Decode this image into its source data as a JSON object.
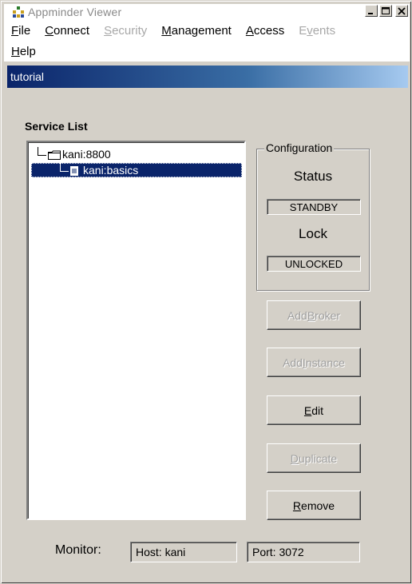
{
  "window": {
    "title": "Appminder Viewer",
    "controls": {
      "minimize": "_",
      "maximize": "□",
      "close": "×"
    }
  },
  "menu": {
    "items": [
      {
        "label": "File",
        "mnemonic": "F",
        "rest": "ile",
        "disabled": false
      },
      {
        "label": "Connect",
        "mnemonic": "C",
        "rest": "onnect",
        "disabled": false
      },
      {
        "label": "Security",
        "mnemonic": "S",
        "rest": "ecurity",
        "disabled": true
      },
      {
        "label": "Management",
        "mnemonic": "M",
        "rest": "anagement",
        "disabled": false
      },
      {
        "label": "Access",
        "mnemonic": "A",
        "rest": "ccess",
        "disabled": false
      },
      {
        "label": "Events",
        "pre": "E",
        "mnemonic": "v",
        "rest": "ents",
        "disabled": true
      },
      {
        "label": "Help",
        "mnemonic": "H",
        "rest": "elp",
        "disabled": false
      }
    ]
  },
  "inner_window": {
    "title": "tutorial"
  },
  "service_list": {
    "heading": "Service List",
    "nodes": [
      {
        "label": "kani:8800",
        "icon": "folder-icon"
      },
      {
        "label": "kani:basics",
        "icon": "document-icon",
        "selected": true
      }
    ]
  },
  "configuration": {
    "legend": "Configuration",
    "status_label": "Status",
    "status_value": "STANDBY",
    "lock_label": "Lock",
    "lock_value": "UNLOCKED"
  },
  "buttons": {
    "add_broker": {
      "pre": "Add ",
      "mnemonic": "B",
      "rest": "roker",
      "disabled": true
    },
    "add_instance": {
      "pre": "Add ",
      "mnemonic": "I",
      "rest": "nstance",
      "disabled": true
    },
    "edit": {
      "pre": "",
      "mnemonic": "E",
      "rest": "dit",
      "disabled": false
    },
    "duplicate": {
      "pre": "",
      "mnemonic": "D",
      "rest": "uplicate",
      "disabled": true
    },
    "remove": {
      "pre": "",
      "mnemonic": "R",
      "rest": "emove",
      "disabled": false
    }
  },
  "monitor": {
    "label": "Monitor:",
    "host": "Host: kani",
    "port": "Port: 3072"
  },
  "colors": {
    "face": "#d4d0c8",
    "selection": "#0a246a",
    "title_gradient_start": "#0a246a",
    "title_gradient_end": "#a6caf0",
    "disabled_text": "#a0a0a0"
  }
}
